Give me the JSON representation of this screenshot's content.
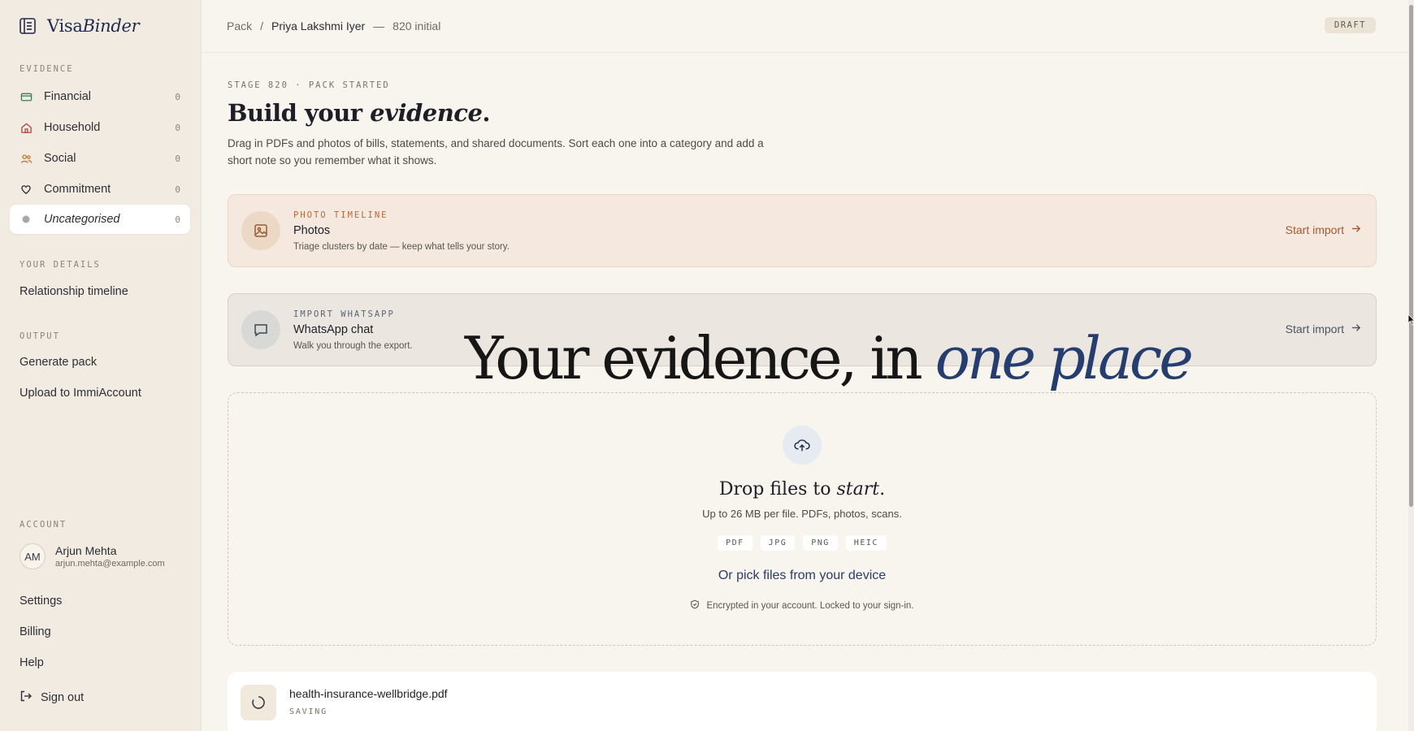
{
  "brand": {
    "name_regular": "Visa",
    "name_italic": "Binder"
  },
  "sidebar": {
    "evidence_label": "EVIDENCE",
    "evidence_items": [
      {
        "label": "Financial",
        "count": "0",
        "icon": "card-icon"
      },
      {
        "label": "Household",
        "count": "0",
        "icon": "house-icon"
      },
      {
        "label": "Social",
        "count": "0",
        "icon": "people-icon"
      },
      {
        "label": "Commitment",
        "count": "0",
        "icon": "heart-icon"
      },
      {
        "label": "Uncategorised",
        "count": "0",
        "icon": "dot-icon",
        "active": true
      }
    ],
    "details_label": "YOUR DETAILS",
    "details_items": [
      "Relationship timeline"
    ],
    "output_label": "OUTPUT",
    "output_items": [
      "Generate pack",
      "Upload to ImmiAccount"
    ],
    "account_label": "ACCOUNT",
    "user": {
      "initials": "AM",
      "name": "Arjun Mehta",
      "email": "arjun.mehta@example.com"
    },
    "account_items": [
      "Settings",
      "Billing",
      "Help"
    ],
    "signout": "Sign out"
  },
  "header": {
    "crumb_root": "Pack",
    "crumb_sep": "/",
    "crumb_person": "Priya Lakshmi Iyer",
    "crumb_dash": "—",
    "crumb_stage": "820 initial",
    "status_badge": "DRAFT"
  },
  "main": {
    "stage": "STAGE 820 · PACK STARTED",
    "heading_regular": "Build your ",
    "heading_italic": "evidence",
    "heading_end": ".",
    "intro": "Drag in PDFs and photos of bills, statements, and shared documents. Sort each one into a category and add a short note so you remember what it shows.",
    "cards": [
      {
        "kicker": "PHOTO TIMELINE",
        "title": "Photos",
        "desc": "Triage clusters by date — keep what tells your story.",
        "cta": "Start import"
      },
      {
        "kicker": "IMPORT WHATSAPP",
        "title": "WhatsApp chat",
        "desc": "Walk you through the export.",
        "cta": "Start import"
      }
    ],
    "overlay_regular": "Your evidence, in ",
    "overlay_italic": "one place",
    "drop": {
      "title_regular": "Drop files to ",
      "title_italic": "start",
      "title_end": ".",
      "subtitle": "Up to 26 MB per file. PDFs, photos, scans.",
      "formats": [
        "PDF",
        "JPG",
        "PNG",
        "HEIC"
      ],
      "pick": "Or pick files from your device",
      "encryption": "Encrypted in your account. Locked to your sign-in."
    },
    "file": {
      "name": "health-insurance-wellbridge.pdf",
      "status": "SAVING"
    }
  },
  "colors": {
    "accent_navy": "#253d6f",
    "photo_accent": "#b56a3e",
    "sidebar_bg": "#f1ebe1",
    "page_bg": "#f8f5ef"
  }
}
